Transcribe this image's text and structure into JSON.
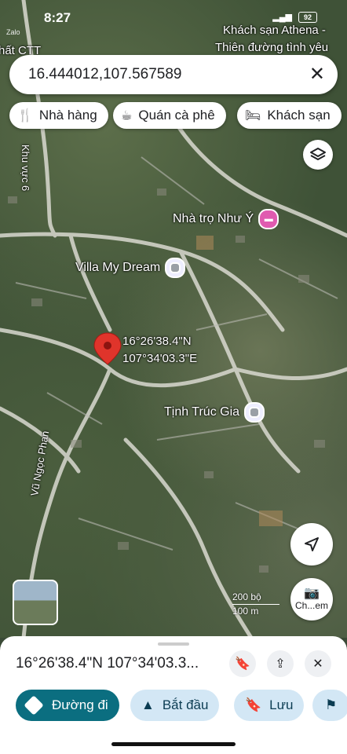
{
  "status_bar": {
    "time": "8:27",
    "app": "Zalo",
    "battery": "92"
  },
  "search": {
    "query": "16.444012,107.567589"
  },
  "chips": [
    {
      "label": "Nhà hàng",
      "icon": "restaurant-icon"
    },
    {
      "label": "Quán cà phê",
      "icon": "cafe-icon"
    },
    {
      "label": "Khách sạn",
      "icon": "hotel-icon"
    }
  ],
  "map_labels": {
    "top_left": "hất CTT",
    "top_right_1": "Khách sạn Athena -",
    "top_right_2": "Thiên đường tình yêu",
    "road_khu_vuc": "Khu vực 6",
    "road_vu_ngoc_phan": "Vũ Ngọc Phan"
  },
  "pois": [
    {
      "label": "Nhà trọ Như Ý"
    },
    {
      "label": "Villa My Dream"
    },
    {
      "label": "Tịnh Trúc Gia"
    }
  ],
  "pin": {
    "lat": "16°26'38.4\"N",
    "lng": "107°34'03.3\"E"
  },
  "map_controls": {
    "streetview_label": "Ch...em",
    "scale_ft": "200 bộ",
    "scale_m": "100 m"
  },
  "sheet": {
    "title": "16°26'38.4\"N 107°34'03.3...",
    "actions": [
      {
        "label": "Đường đi",
        "primary": true
      },
      {
        "label": "Bắt đầu"
      },
      {
        "label": "Lưu"
      }
    ]
  },
  "colors": {
    "primary": "#0b6e80",
    "secondary_bg": "#d3e7f5",
    "pin": "#e0342b"
  }
}
